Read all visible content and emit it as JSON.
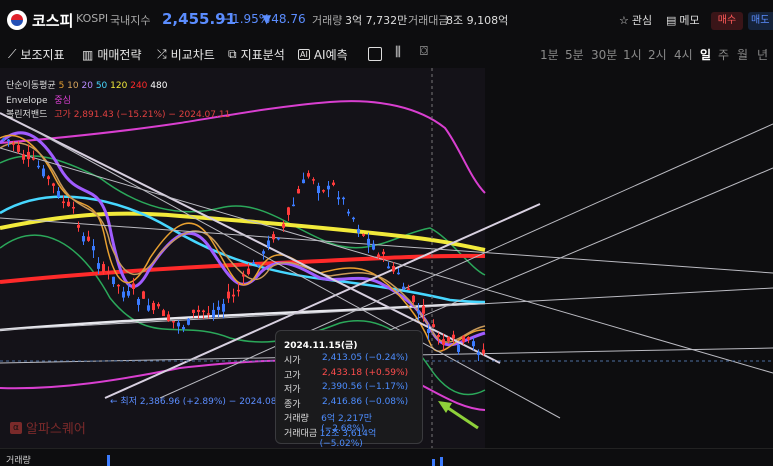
{
  "header": {
    "name": "코스피",
    "code": "KOSPI",
    "market": "국내지수",
    "price": "2,455.91",
    "change_pct": "−1.95%",
    "change_pts": "▼48.76",
    "volume_label": "거래량",
    "volume_value": "3억 7,732만",
    "amount_label": "거래대금",
    "amount_value": "8조 9,108억",
    "watch_label": "관심",
    "memo_label": "메모",
    "buy_label": "매수",
    "sell_label": "매도"
  },
  "toolbar": {
    "indicators_label": "보조지표",
    "strategy_label": "매매전략",
    "compare_label": "비교차트",
    "analysis_label": "지표분석",
    "ai_label": "AI예측",
    "timeframes": [
      "1분",
      "5분",
      "30분",
      "1시",
      "2시",
      "4시",
      "일",
      "주",
      "월",
      "년"
    ],
    "active_timeframe": "일"
  },
  "legend": {
    "ma_label": "단순이동평균",
    "ma_periods": [
      "5",
      "10",
      "20",
      "50",
      "120",
      "240",
      "480"
    ],
    "envelope_label": "Envelope",
    "envelope_sub": "중심",
    "bollinger_label": "볼린저밴드",
    "bollinger_sub": "고가 2,891.43 (−15.21%) − 2024.07.11"
  },
  "annotations": {
    "low_label": "최저 2,386.96 (+2.89%) − 2024.08.05",
    "watermark": "알파스퀘어"
  },
  "tooltip": {
    "date": "2024.11.15(금)",
    "rows": [
      {
        "label": "시가",
        "value": "2,413.05 (−0.24%)",
        "color": "#4d8dff"
      },
      {
        "label": "고가",
        "value": "2,433.18 (+0.59%)",
        "color": "#ff4d4d"
      },
      {
        "label": "저가",
        "value": "2,390.56 (−1.17%)",
        "color": "#4d8dff"
      },
      {
        "label": "종가",
        "value": "2,416.86 (−0.08%)",
        "color": "#4d8dff"
      },
      {
        "label": "거래량",
        "value": "6억 2,217만 (−2.68%)",
        "color": "#4d8dff"
      },
      {
        "label": "거래대금",
        "value": "12조 3,614억 (−5.02%)",
        "color": "#4d8dff"
      }
    ]
  },
  "volume_panel": {
    "label": "거래량"
  },
  "colors": {
    "up": "#ff3b3b",
    "down": "#3b7bff",
    "ma5": "#e8a030",
    "ma10": "#d9a55c",
    "ma20": "#b98cff",
    "ma50": "#47d7ff",
    "ma120": "#f2ea3b",
    "ma240": "#ff2a2a",
    "ma480": "#ffffff",
    "envelope": "#d93fd0",
    "bollinger": "#2ba85a"
  }
}
